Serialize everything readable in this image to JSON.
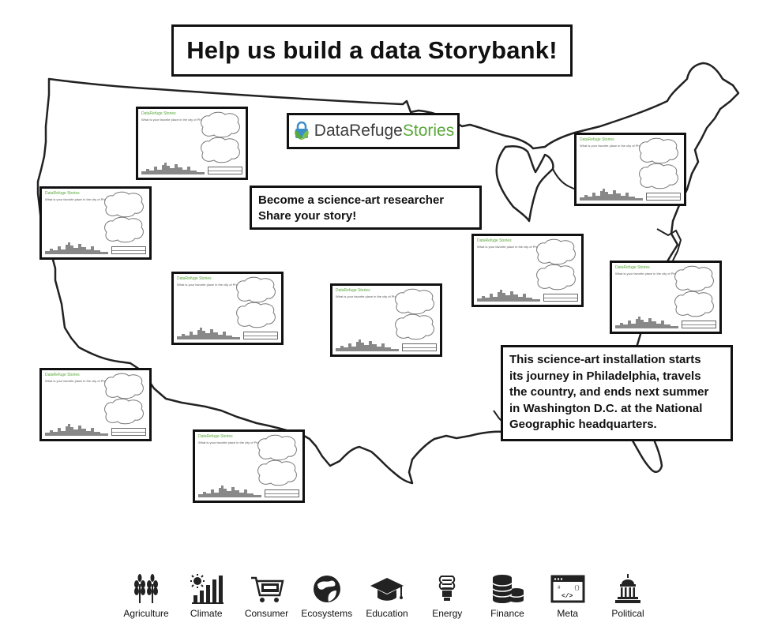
{
  "title": "Help us build a data Storybank!",
  "logo": {
    "part1": "DataRefuge",
    "part2": "Stories"
  },
  "callout_research": {
    "line1": "Become a science-art researcher",
    "line2": "Share your story!"
  },
  "callout_journey": {
    "line1": "This science-art installation starts",
    "line2": "its journey in Philadelphia, travels",
    "line3": "the country, and ends next summer",
    "line4": "in Washington D.C. at the National",
    "line5": "Geographic headquarters."
  },
  "card": {
    "brand": "DataRefuge Stories",
    "question": "What is your favorite place in the city of Philadelphia?"
  },
  "categories": [
    {
      "label": "Agriculture",
      "icon": "wheat-icon"
    },
    {
      "label": "Climate",
      "icon": "sun-bars-icon"
    },
    {
      "label": "Consumer",
      "icon": "shopping-cart-icon"
    },
    {
      "label": "Ecosystems",
      "icon": "globe-leaf-icon"
    },
    {
      "label": "Education",
      "icon": "graduation-cap-icon"
    },
    {
      "label": "Energy",
      "icon": "lightbulb-icon"
    },
    {
      "label": "Finance",
      "icon": "coin-stacks-icon"
    },
    {
      "label": "Meta",
      "icon": "code-window-icon"
    },
    {
      "label": "Political",
      "icon": "capitol-icon"
    }
  ],
  "colors": {
    "brand_green": "#59a83a",
    "brand_gray": "#3d3d3d",
    "outline": "#111111"
  }
}
